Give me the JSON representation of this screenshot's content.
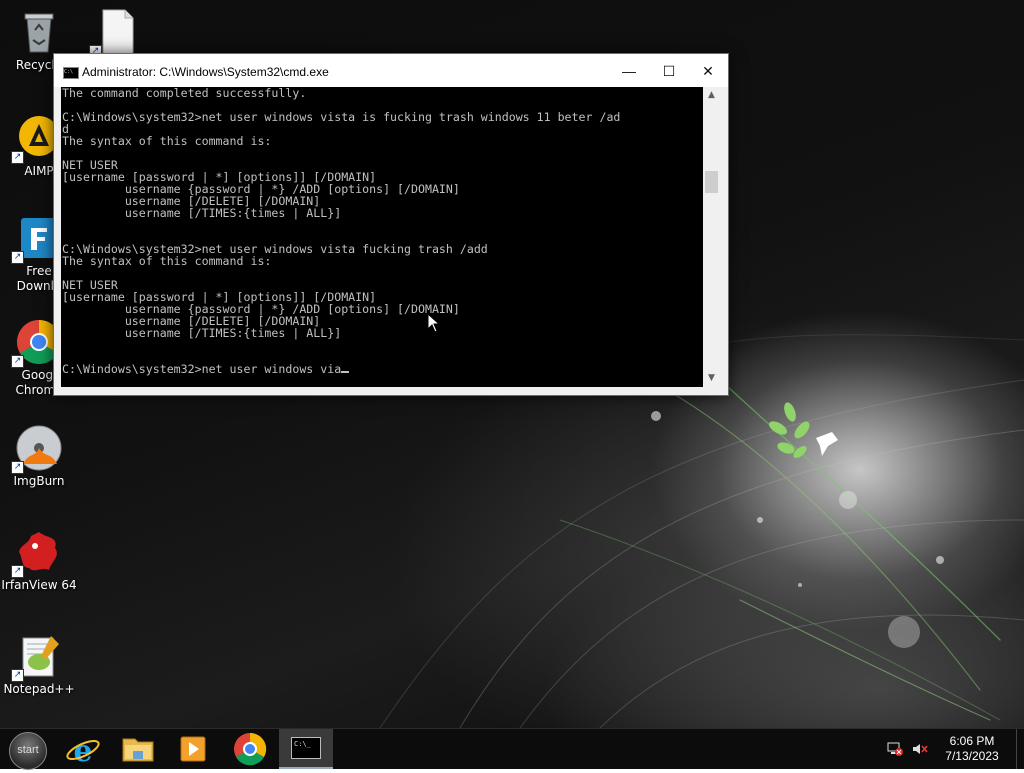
{
  "desktop": {
    "icons": [
      {
        "label": "Recycle"
      },
      {
        "label": ""
      },
      {
        "label": "AIMP"
      },
      {
        "label": "Free\nDownlo"
      },
      {
        "label": "Googl\nChrome"
      },
      {
        "label": "ImgBurn"
      },
      {
        "label": "IrfanView 64"
      },
      {
        "label": "Notepad++"
      }
    ]
  },
  "cmd": {
    "title": "Administrator: C:\\Windows\\System32\\cmd.exe",
    "minimize_glyph": "—",
    "maximize_glyph": "☐",
    "close_glyph": "✕",
    "console_text": "The command completed successfully.\n\nC:\\Windows\\system32>net user windows vista is fucking trash windows 11 beter /ad\nd\nThe syntax of this command is:\n\nNET USER\n[username [password | *] [options]] [/DOMAIN]\n         username {password | *} /ADD [options] [/DOMAIN]\n         username [/DELETE] [/DOMAIN]\n         username [/TIMES:{times | ALL}]\n\n\nC:\\Windows\\system32>net user windows vista fucking trash /add\nThe syntax of this command is:\n\nNET USER\n[username [password | *] [options]] [/DOMAIN]\n         username {password | *} /ADD [options] [/DOMAIN]\n         username [/DELETE] [/DOMAIN]\n         username [/TIMES:{times | ALL}]\n\n\nC:\\Windows\\system32>net user windows via",
    "scroll_up_glyph": "▲",
    "scroll_down_glyph": "▼"
  },
  "taskbar": {
    "start_label": "start",
    "apps": [
      {
        "name": "internet-explorer-icon"
      },
      {
        "name": "file-explorer-icon"
      },
      {
        "name": "media-player-icon"
      },
      {
        "name": "chrome-icon"
      },
      {
        "name": "cmd-icon",
        "glyph": "C:\\_"
      }
    ],
    "time": "6:06 PM",
    "date": "7/13/2023"
  },
  "colors": {
    "console_bg": "#000000",
    "console_fg": "#c0c0c0",
    "taskbar_bg": "#0c0c0c"
  }
}
